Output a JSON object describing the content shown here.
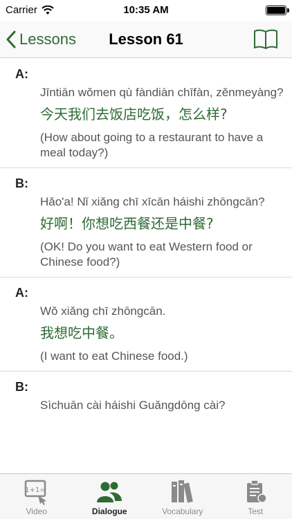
{
  "status_bar": {
    "carrier": "Carrier",
    "time": "10:35 AM"
  },
  "nav": {
    "back_label": "Lessons",
    "title": "Lesson 61"
  },
  "dialogue": [
    {
      "speaker": "A:",
      "pinyin": "Jīntiān wǒmen qù fàndiàn chīfàn, zěnmeyàng?",
      "hanzi": "今天我们去饭店吃饭，怎么样?",
      "english": "(How about going to a restaurant to have a meal today?)"
    },
    {
      "speaker": "B:",
      "pinyin": "Hǎo'a! Nǐ xiǎng chī xīcān háishi zhōngcān?",
      "hanzi": "好啊！你想吃西餐还是中餐?",
      "english": "(OK! Do you want to eat Western food or Chinese food?)"
    },
    {
      "speaker": "A:",
      "pinyin": "Wǒ xiǎng chī zhōngcān.",
      "hanzi": "我想吃中餐。",
      "english": "(I want to eat Chinese food.)"
    },
    {
      "speaker": "B:",
      "pinyin": "Sìchuān cài háishi Guǎngdōng cài?",
      "hanzi": "",
      "english": ""
    }
  ],
  "tabs": [
    {
      "label": "Video",
      "icon": "video-icon"
    },
    {
      "label": "Dialogue",
      "icon": "dialogue-icon",
      "active": true
    },
    {
      "label": "Vocabulary",
      "icon": "vocabulary-icon"
    },
    {
      "label": "Test",
      "icon": "test-icon"
    }
  ],
  "colors": {
    "accent": "#2e6b34",
    "inactive": "#8a8a8a"
  }
}
